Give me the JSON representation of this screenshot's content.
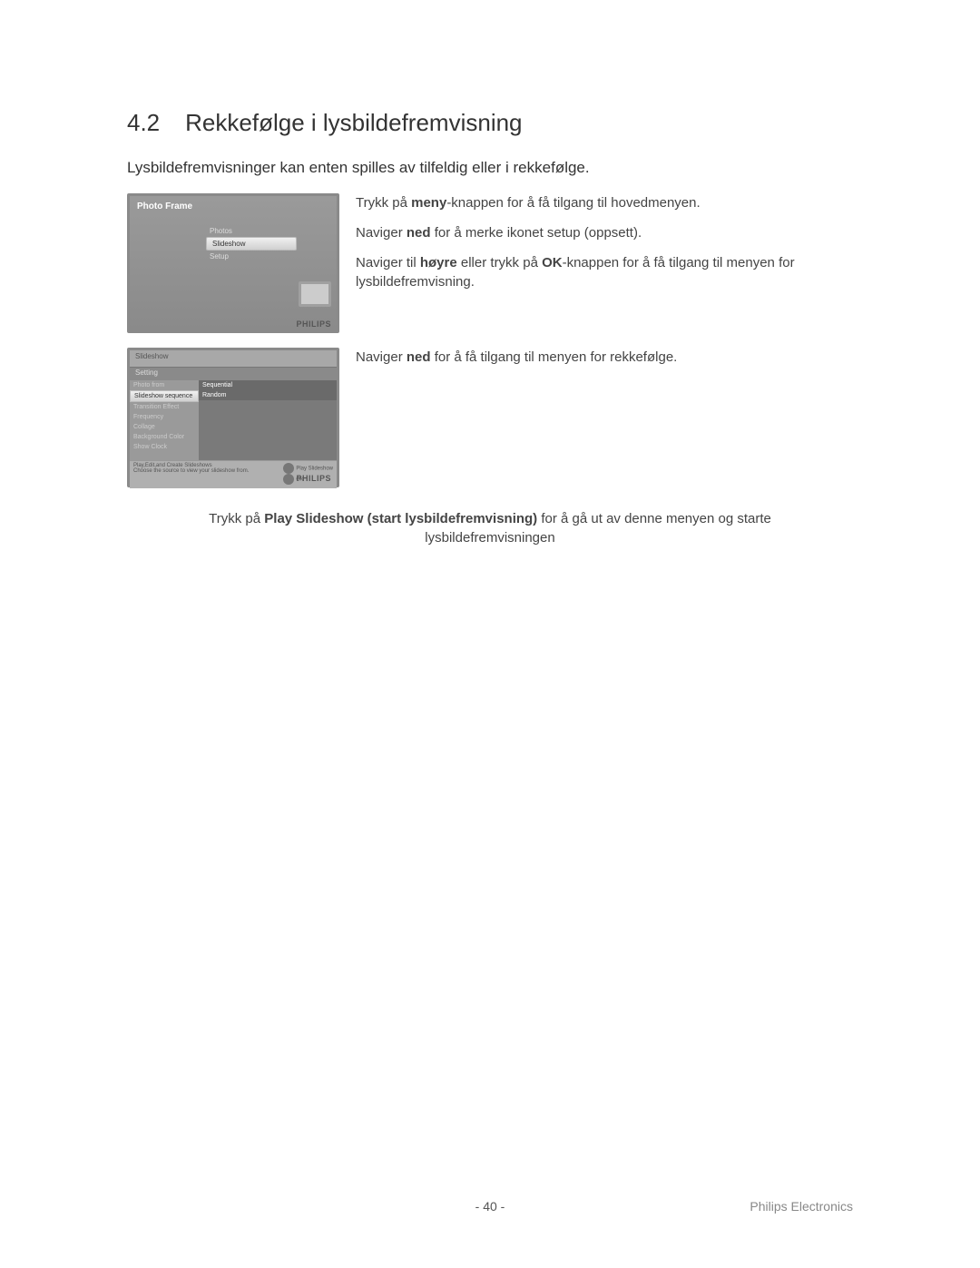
{
  "section": {
    "number": "4.2",
    "title": "Rekkefølge i lysbildefremvisning"
  },
  "intro": "Lysbildefremvisninger kan enten spilles av tilfeldig eller i rekkefølge.",
  "steps1": {
    "l1a": "Trykk på ",
    "l1b": "meny",
    "l1c": "-knappen for å få tilgang til hovedmenyen.",
    "l2a": "Naviger ",
    "l2b": "ned",
    "l2c": " for å merke ikonet setup (oppsett).",
    "l3a": "Naviger til ",
    "l3b": "høyre",
    "l3c": " eller trykk på ",
    "l3d": "OK",
    "l3e": "-knappen for å få tilgang til menyen for lysbildefremvisning."
  },
  "steps2": {
    "l1a": "Naviger ",
    "l1b": "ned",
    "l1c": " for å få tilgang til menyen for rekkefølge."
  },
  "final": {
    "a": "Trykk på ",
    "b": "Play Slideshow (start lysbildefremvisning)",
    "c": " for å gå ut av denne menyen og starte lysbildefremvisningen"
  },
  "shot1": {
    "header": "Photo Frame",
    "menu": [
      "Photos",
      "Slideshow",
      "Setup"
    ],
    "logo": "PHILIPS"
  },
  "shot2": {
    "title": "Slideshow",
    "sub": "Setting",
    "left": [
      "Photo from",
      "Slideshow sequence",
      "Transition Effect",
      "Frequency",
      "Collage",
      "Background Color",
      "Show Clock"
    ],
    "right": [
      "Sequential",
      "Random"
    ],
    "status_left1": "Play,Edit,and Create Slideshows",
    "status_left2": "Choose the source to view your slideshow from.",
    "status_r1": "Play Slideshow",
    "status_r2": "Ok",
    "logo": "PHILIPS"
  },
  "footer": {
    "page": "- 40 -",
    "corp": "Philips Electronics"
  }
}
